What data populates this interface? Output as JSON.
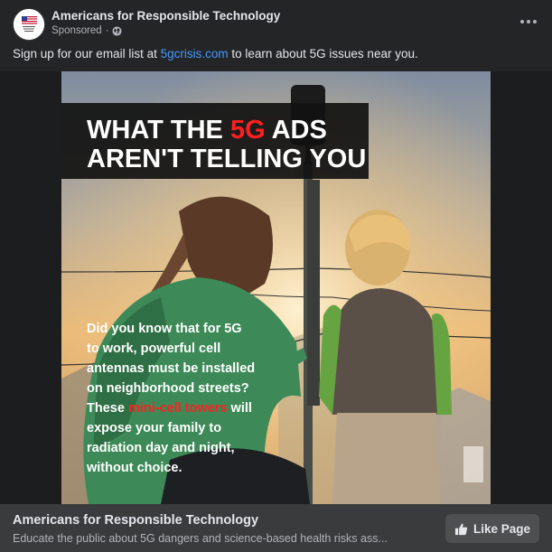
{
  "post": {
    "page_name": "Americans for Responsible Technology",
    "sponsored_label": "Sponsored",
    "separator": "·",
    "privacy_icon": "globe-icon",
    "more_icon": "more-options-icon",
    "message_before": "Sign up for our email list at ",
    "message_link": "5gcrisis.com",
    "message_after": " to learn about 5G issues near you."
  },
  "ad_image": {
    "headline_line1_a": "WHAT THE ",
    "headline_line1_highlight": "5G",
    "headline_line1_b": " ADS",
    "headline_line2": "AREN'T TELLING YOU",
    "body_lines": [
      "Did you know that for 5G",
      "to work, powerful cell",
      "antennas must be installed",
      "on neighborhood streets?"
    ],
    "line5_a": "These ",
    "line5_highlight": "mini-cell towers",
    "line5_b": " will",
    "body_lines_after": [
      "expose your family to",
      "radiation day and night,",
      "without choice."
    ],
    "colors": {
      "highlight": "#ff1f1f",
      "text": "#ffffff",
      "banner": "#111111"
    }
  },
  "footer": {
    "title": "Americans for Responsible Technology",
    "description": "Educate the public about 5G dangers and science-based health risks ass...",
    "like_label": "Like Page",
    "like_icon": "thumbs-up-icon"
  }
}
